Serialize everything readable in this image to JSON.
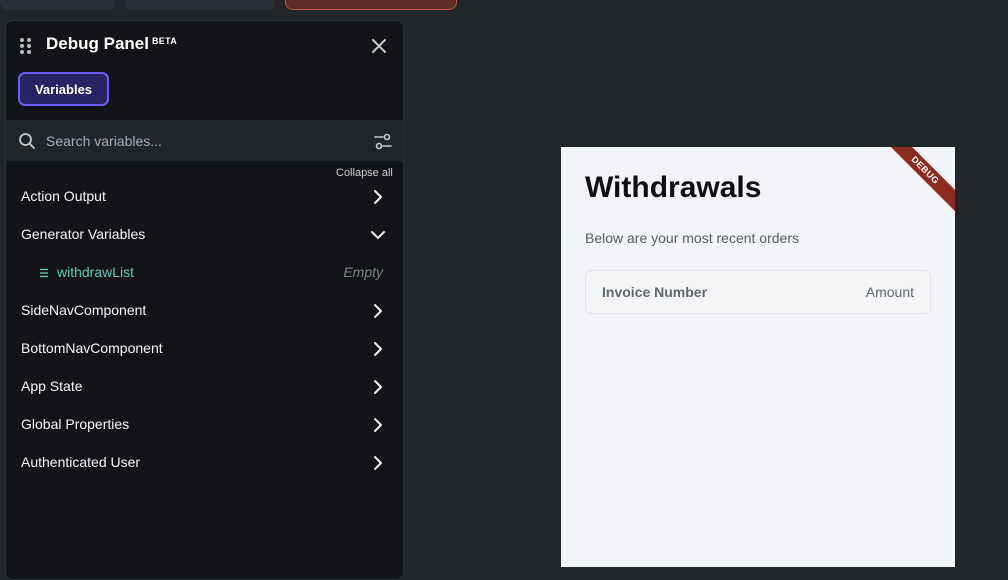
{
  "debug_panel": {
    "title": "Debug Panel",
    "badge": "BETA",
    "tabs": [
      {
        "label": "Variables",
        "active": true
      }
    ],
    "search": {
      "placeholder": "Search variables...",
      "value": ""
    },
    "collapse_all_label": "Collapse all",
    "sections": [
      {
        "label": "Action Output",
        "expanded": false
      },
      {
        "label": "Generator Variables",
        "expanded": true,
        "children": [
          {
            "name": "withdrawList",
            "value": "Empty",
            "icon": "list-icon"
          }
        ]
      },
      {
        "label": "SideNavComponent",
        "expanded": false
      },
      {
        "label": "BottomNavComponent",
        "expanded": false
      },
      {
        "label": "App State",
        "expanded": false
      },
      {
        "label": "Global Properties",
        "expanded": false
      },
      {
        "label": "Authenticated User",
        "expanded": false
      }
    ]
  },
  "preview": {
    "ribbon": "DEBUG",
    "title": "Withdrawals",
    "subtitle": "Below are your most recent orders",
    "table": {
      "columns": [
        "Invoice Number",
        "Amount"
      ]
    }
  },
  "colors": {
    "background": "#22252a",
    "panel": "#131417",
    "accent": "#6a5cf5",
    "variable_name": "#5ec9b4",
    "ribbon": "#8b2a1e"
  }
}
